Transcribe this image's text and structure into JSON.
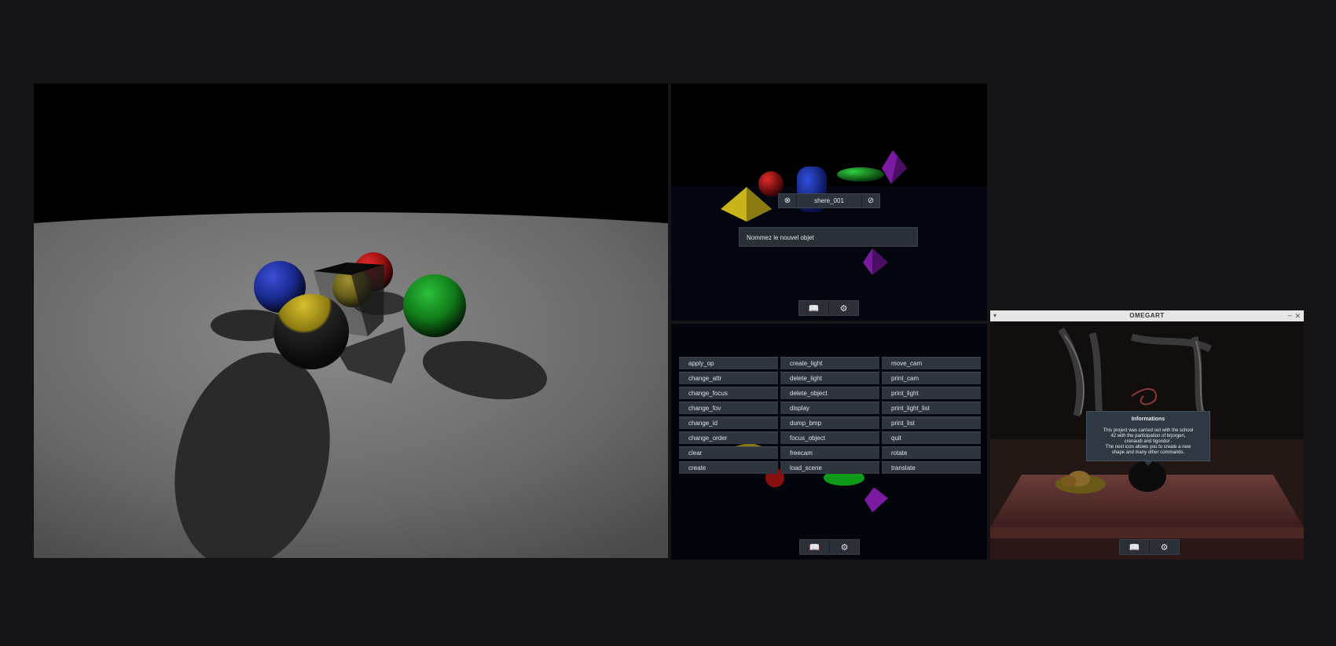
{
  "viewports": {
    "main": {
      "description_name": "render-main"
    }
  },
  "naming_dialog": {
    "object_name": "shere_001",
    "cancel_icon": "close-circle-icon",
    "confirm_icon": "check-circle-icon",
    "prompt": "Nommez le nouvel objet"
  },
  "toolbar": {
    "book_icon": "📖",
    "gear_icon": "⚙"
  },
  "commands": [
    "apply_op",
    "create_light",
    "move_cam",
    "change_attr",
    "delete_light",
    "print_cam",
    "change_focus",
    "delete_object",
    "print_light",
    "change_fov",
    "display",
    "print_light_list",
    "change_id",
    "dump_bmp",
    "print_list",
    "change_order",
    "focus_object",
    "quit",
    "clear",
    "freecam",
    "rotate",
    "create",
    "load_scene",
    "translate"
  ],
  "window": {
    "title": "OMEGART",
    "menu_glyph": "▾",
    "minimize_glyph": "–",
    "close_glyph": "✕"
  },
  "info_popup": {
    "title": "Informations",
    "lines": [
      "This project was carried out with the school",
      "42 with the participation of brjorgen,",
      "crenaudi and tigondol .",
      "The next icon allows you to create a new",
      "shape and many other commands."
    ]
  },
  "colors": {
    "background": "#151517",
    "panel_ui": "#2e353e",
    "sphere_blue": "#1b2fa8",
    "sphere_red": "#c41616",
    "sphere_yellow": "#c9b21a",
    "sphere_green": "#159a1f",
    "pyramid_purple": "#7a1aa0"
  }
}
